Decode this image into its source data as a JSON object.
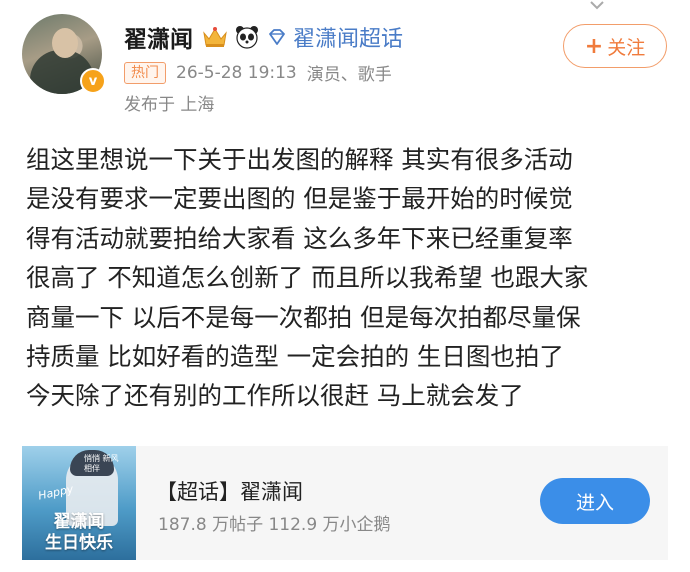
{
  "post": {
    "username": "翟潇闻",
    "supertopic_link": "翟潇闻超话",
    "hot_tag": "热门",
    "timestamp": "26-5-28 19:13",
    "category": "演员、歌手",
    "location": "发布于 上海",
    "follow_plus": "+",
    "follow_label": "关注",
    "verified_mark": "v",
    "body_lines": [
      "组这里想说一下关于出发图的解释 其实有很多活动",
      "是没有要求一定要出图的 但是鉴于最开始的时候觉",
      "得有活动就要拍给大家看 这么多年下来已经重复率",
      "很高了 不知道怎么创新了 而且所以我希望 也跟大家",
      "商量一下 以后不是每一次都拍 但是每次拍都尽量保",
      "持质量 比如好看的造型 一定会拍的 生日图也拍了",
      "今天除了还有别的工作所以很赶 马上就会发了"
    ]
  },
  "card": {
    "title": "【超话】翟潇闻",
    "stats": "187.8 万帖子  112.9 万小企鹅",
    "enter_label": "进入",
    "cover_title_line1": "翟潇闻",
    "cover_title_line2": "生日快乐",
    "cover_small_text": "悄悄 新风相伴",
    "cover_script": "Happy"
  },
  "icons": {
    "crown": "crown-icon",
    "panda": "panda-icon",
    "gem": "gem-icon",
    "more": "chevron-down-icon"
  },
  "colors": {
    "accent_orange": "#f07b3c",
    "link_blue": "#4a7cc7",
    "enter_blue": "#3b8ee8"
  }
}
